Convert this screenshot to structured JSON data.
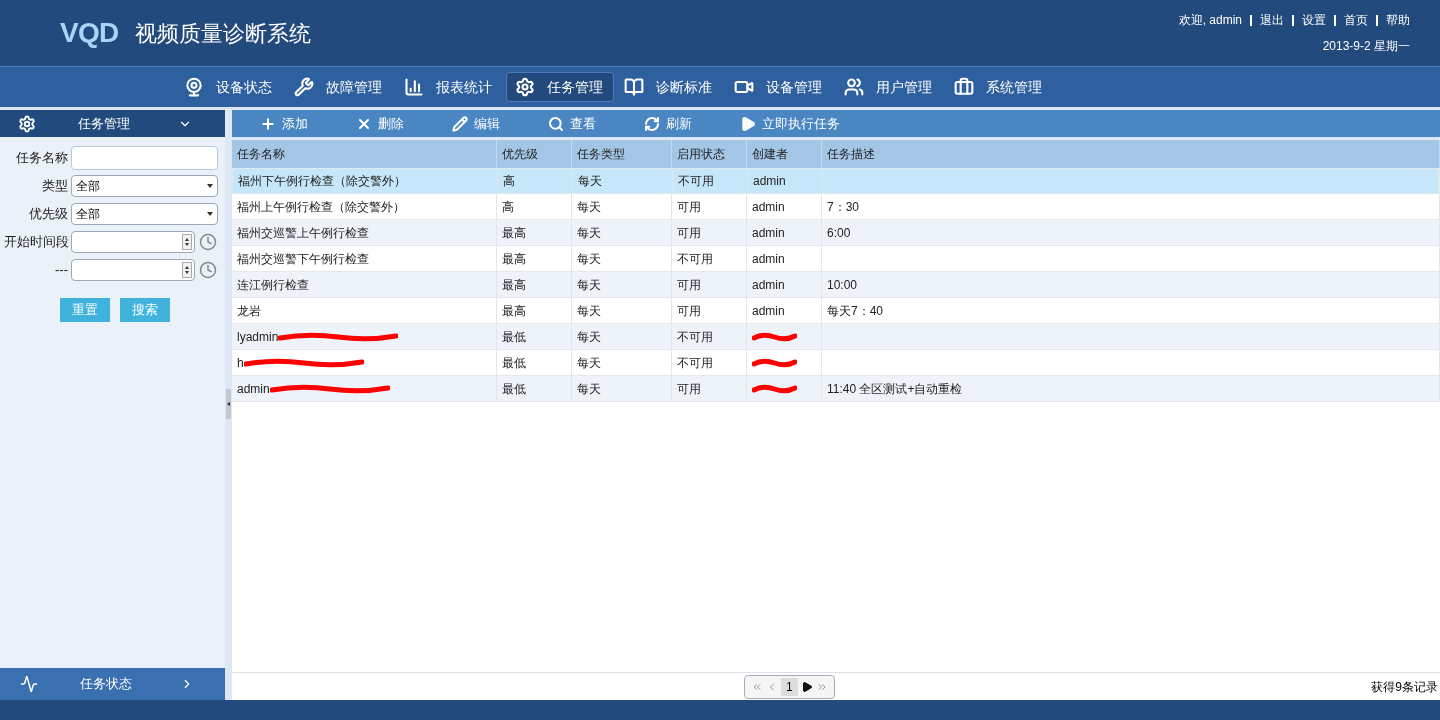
{
  "header": {
    "logo": "VQD",
    "title": "视频质量诊断系统",
    "user_links": [
      "欢迎, admin",
      "退出",
      "设置",
      "首页",
      "帮助"
    ],
    "date": "2013-9-2 星期一"
  },
  "nav": [
    {
      "label": "设备状态",
      "selected": false
    },
    {
      "label": "故障管理",
      "selected": false
    },
    {
      "label": "报表统计",
      "selected": false
    },
    {
      "label": "任务管理",
      "selected": true
    },
    {
      "label": "诊断标准",
      "selected": false
    },
    {
      "label": "设备管理",
      "selected": false
    },
    {
      "label": "用户管理",
      "selected": false
    },
    {
      "label": "系统管理",
      "selected": false
    }
  ],
  "sidebar": {
    "title": "任务管理",
    "fields": [
      {
        "kind": "text",
        "label": "任务名称"
      },
      {
        "kind": "select",
        "label": "类型",
        "value": "全部"
      },
      {
        "kind": "select",
        "label": "优先级",
        "value": "全部"
      },
      {
        "kind": "time",
        "label": "开始时间段"
      },
      {
        "kind": "time",
        "label": "---"
      }
    ],
    "buttons": [
      "重置",
      "搜索"
    ],
    "footer": "任务状态"
  },
  "toolbar": [
    "添加",
    "删除",
    "编辑",
    "查看",
    "刷新",
    "立即执行任务"
  ],
  "table": {
    "columns": [
      "任务名称",
      "优先级",
      "任务类型",
      "启用状态",
      "创建者",
      "任务描述"
    ],
    "rows": [
      {
        "selected": true,
        "cells": [
          "福州下午例行检查（除交警外）",
          "高",
          "每天",
          "不可用",
          "admin",
          ""
        ]
      },
      {
        "selected": false,
        "cells": [
          "福州上午例行检查（除交警外）",
          "高",
          "每天",
          "可用",
          "admin",
          "7：30"
        ]
      },
      {
        "selected": false,
        "cells": [
          "福州交巡警上午例行检查",
          "最高",
          "每天",
          "可用",
          "admin",
          "6:00"
        ]
      },
      {
        "selected": false,
        "cells": [
          "福州交巡警下午例行检查",
          "最高",
          "每天",
          "不可用",
          "admin",
          ""
        ]
      },
      {
        "selected": false,
        "cells": [
          "连江例行检查",
          "最高",
          "每天",
          "可用",
          "admin",
          "10:00"
        ]
      },
      {
        "selected": false,
        "cells": [
          "龙岩",
          "最高",
          "每天",
          "可用",
          "admin",
          "每天7：40"
        ]
      },
      {
        "selected": false,
        "redacted": true,
        "cells": [
          "lyadmin",
          "最低",
          "每天",
          "不可用",
          "",
          ""
        ]
      },
      {
        "selected": false,
        "redacted": true,
        "cells": [
          "h",
          "最低",
          "每天",
          "不可用",
          "",
          ""
        ]
      },
      {
        "selected": false,
        "redacted": true,
        "cells": [
          "admin",
          "最低",
          "每天",
          "可用",
          "",
          "11:40 全区测试+自动重检"
        ]
      }
    ]
  },
  "pager": {
    "page": "1",
    "summary": "获得9条记录"
  }
}
